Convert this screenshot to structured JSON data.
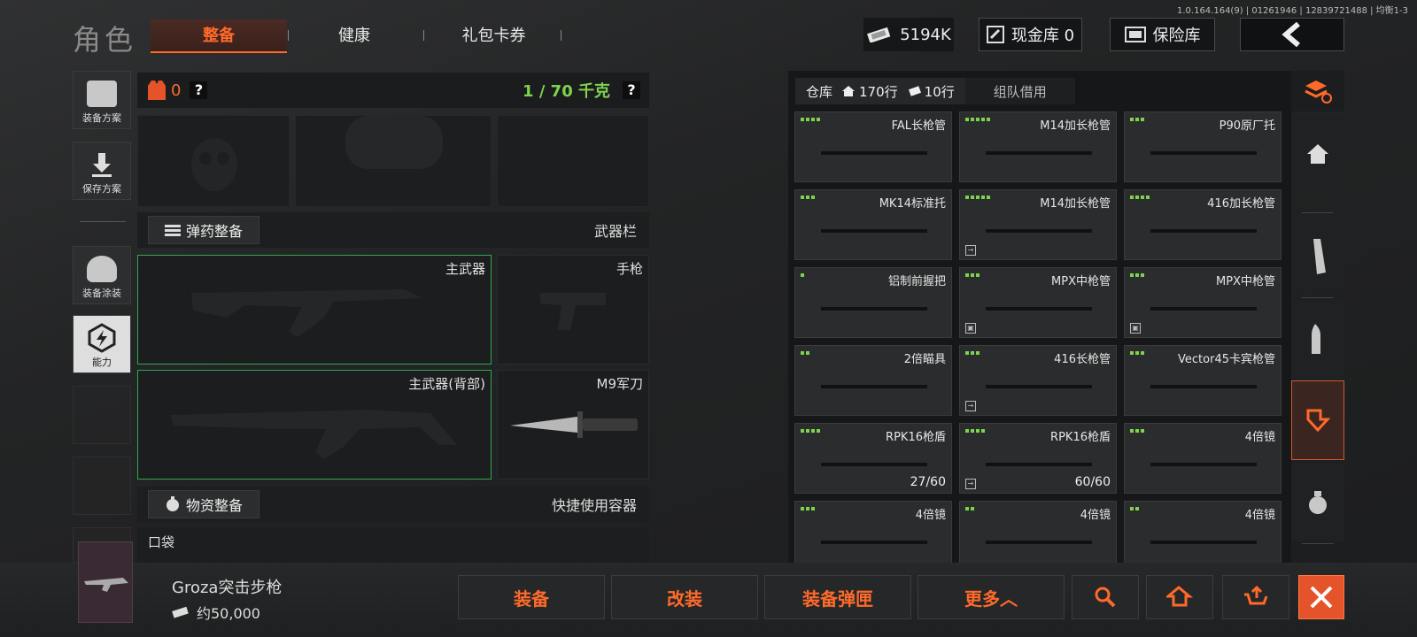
{
  "version": "1.0.164.164(9) | 01261946 | 12839721488 | 均衡1-3",
  "header": {
    "title": "角色",
    "tabs": [
      {
        "label": "整备",
        "active": true
      },
      {
        "label": "健康"
      },
      {
        "label": "礼包卡券"
      }
    ],
    "money": "5194K",
    "cash_vault": "现金库 0",
    "insurance": "保险库"
  },
  "sidebar": {
    "items": [
      {
        "label": "装备方案",
        "icon": "vest-icon"
      },
      {
        "label": "保存方案",
        "icon": "download-icon"
      },
      {
        "label": "装备涂装",
        "icon": "helmet-icon"
      },
      {
        "label": "能力",
        "icon": "lightning-hex-icon",
        "active": true
      }
    ]
  },
  "loadout": {
    "armor_count": "0",
    "weight": "1 / 70 千克",
    "ammo_section": "弹药整备",
    "weapon_bar": "武器栏",
    "primary": "主武器",
    "pistol": "手枪",
    "primary_back": "主武器(背部)",
    "melee": "M9军刀",
    "supply_section": "物资整备",
    "quick_container": "快捷使用容器",
    "pocket": "口袋"
  },
  "warehouse": {
    "tab_label": "仓库",
    "rows_home": "170行",
    "rows_ticket": "10行",
    "team_tab": "组队借用",
    "items": [
      {
        "name": "FAL长枪管",
        "dots": 4,
        "count": "",
        "badge": ""
      },
      {
        "name": "M14加长枪管",
        "dots": 5,
        "count": "",
        "badge": ""
      },
      {
        "name": "P90原厂托",
        "dots": 3,
        "count": "",
        "badge": ""
      },
      {
        "name": "MK14标准托",
        "dots": 3,
        "count": "",
        "badge": ""
      },
      {
        "name": "M14加长枪管",
        "dots": 5,
        "count": "",
        "badge": "→"
      },
      {
        "name": "416加长枪管",
        "dots": 4,
        "count": "",
        "badge": ""
      },
      {
        "name": "铝制前握把",
        "dots": 1,
        "count": "",
        "badge": ""
      },
      {
        "name": "MPX中枪管",
        "dots": 3,
        "count": "",
        "badge": "▣"
      },
      {
        "name": "MPX中枪管",
        "dots": 3,
        "count": "",
        "badge": "▣"
      },
      {
        "name": "2倍瞄具",
        "dots": 2,
        "count": "",
        "badge": ""
      },
      {
        "name": "416长枪管",
        "dots": 3,
        "count": "",
        "badge": "→"
      },
      {
        "name": "Vector45卡宾枪管",
        "dots": 3,
        "count": "",
        "badge": ""
      },
      {
        "name": "RPK16枪盾",
        "dots": 4,
        "count": "27/60",
        "badge": ""
      },
      {
        "name": "RPK16枪盾",
        "dots": 4,
        "count": "60/60",
        "badge": "→"
      },
      {
        "name": "4倍镜",
        "dots": 3,
        "count": "",
        "badge": ""
      },
      {
        "name": "4倍镜",
        "dots": 3,
        "count": "",
        "badge": ""
      },
      {
        "name": "4倍镜",
        "dots": 2,
        "count": "",
        "badge": ""
      },
      {
        "name": "4倍镜",
        "dots": 2,
        "count": "",
        "badge": ""
      }
    ]
  },
  "selected": {
    "name": "Groza突击步枪",
    "price": "约50,000"
  },
  "actions": {
    "equip": "装备",
    "modify": "改装",
    "equip_mag": "装备弹匣",
    "more": "更多︿"
  },
  "colors": {
    "accent": "#ff6a2a",
    "green": "#7ed34e",
    "slot_border_green": "#2ea84f"
  }
}
